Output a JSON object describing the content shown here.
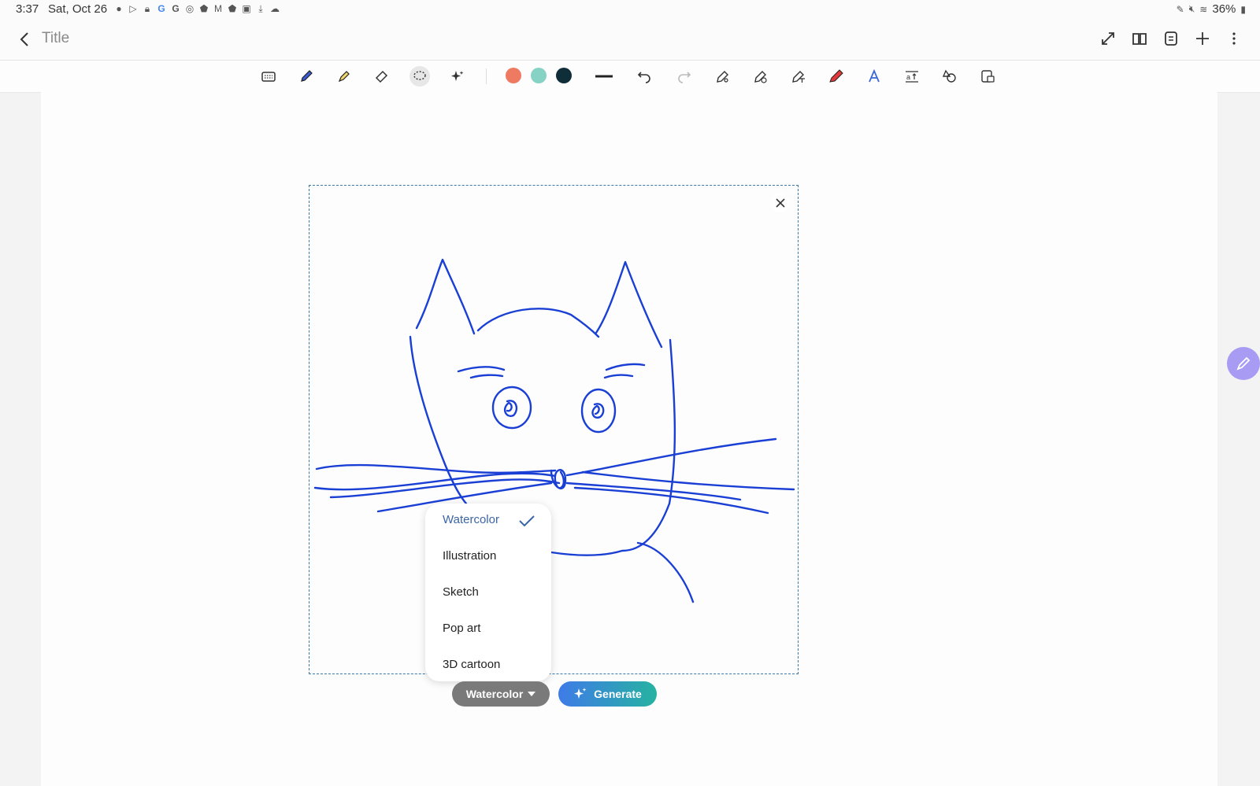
{
  "status": {
    "time": "3:37",
    "date": "Sat, Oct 26",
    "battery": "36%",
    "notification_icons": [
      "messenger-icon",
      "play-store-icon",
      "lock-icon",
      "google-icon",
      "google-icon",
      "target-icon",
      "shield-icon",
      "gmail-icon",
      "shield-icon",
      "image-icon",
      "download-icon",
      "cloud-icon"
    ]
  },
  "header": {
    "title": "Title"
  },
  "toolbar": {
    "tools": [
      "keyboard-icon",
      "pen-icon",
      "highlighter-icon",
      "eraser-icon",
      "lasso-icon",
      "ai-sparkle-icon"
    ],
    "colors": [
      "#ef7a62",
      "#86d3c5",
      "#0f2e3a"
    ],
    "extra_tools": [
      "line-width-icon",
      "undo-icon",
      "redo-icon",
      "pen-settings-icon",
      "pen-add-icon",
      "text-convert-icon",
      "red-pen-icon",
      "handwriting-a-icon",
      "text-size-icon",
      "shapes-icon",
      "lock-note-icon"
    ]
  },
  "dropdown": {
    "items": [
      "Watercolor",
      "Illustration",
      "Sketch",
      "Pop art",
      "3D cartoon"
    ],
    "selected": "Watercolor"
  },
  "actions": {
    "style_label": "Watercolor",
    "generate_label": "Generate"
  },
  "ink_color": "#1a3fd4",
  "accent_colors": {
    "generate_start": "#3f7be8",
    "generate_end": "#26b2a1",
    "float_button": "#a79bf4"
  }
}
